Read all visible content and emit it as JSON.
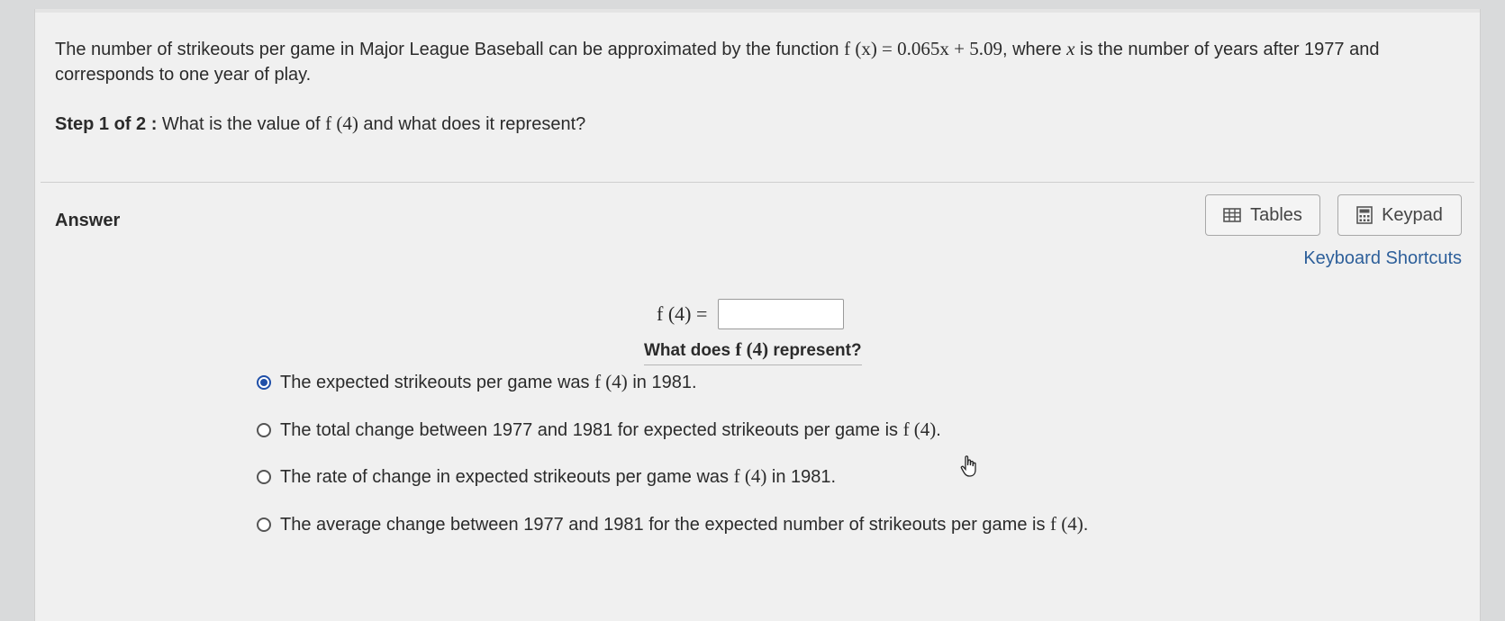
{
  "question": {
    "text_before": "The number of strikeouts per game in Major League Baseball can be approximated by the function ",
    "function": "f (x)  =  0.065x + 5.09",
    "text_after": ", where ",
    "variable": "x",
    "text_end": " is the number of years after 1977 and corresponds to one year of play."
  },
  "step": {
    "label": "Step 1 of 2 :",
    "text_before": " What is the value of ",
    "math": "f (4)",
    "text_after": " and what does it represent?"
  },
  "answer": {
    "label": "Answer",
    "tables_label": "Tables",
    "keypad_label": "Keypad",
    "shortcuts_label": "Keyboard Shortcuts",
    "f4_label": "f (4)  =",
    "f4_value": "",
    "represent_before": "What does ",
    "represent_math": "f (4)",
    "represent_after": " represent?"
  },
  "options": [
    {
      "text_before": "The expected strikeouts per game was ",
      "math": "f (4)",
      "text_after": " in 1981.",
      "selected": true
    },
    {
      "text_before": "The total change between 1977 and 1981 for expected strikeouts per game is ",
      "math": "f (4)",
      "text_after": ".",
      "selected": false
    },
    {
      "text_before": "The rate of change in expected strikeouts per game was ",
      "math": "f (4)",
      "text_after": " in 1981.",
      "selected": false
    },
    {
      "text_before": "The average change between 1977 and 1981 for the expected number of strikeouts per game is ",
      "math": "f (4)",
      "text_after": ".",
      "selected": false
    }
  ]
}
